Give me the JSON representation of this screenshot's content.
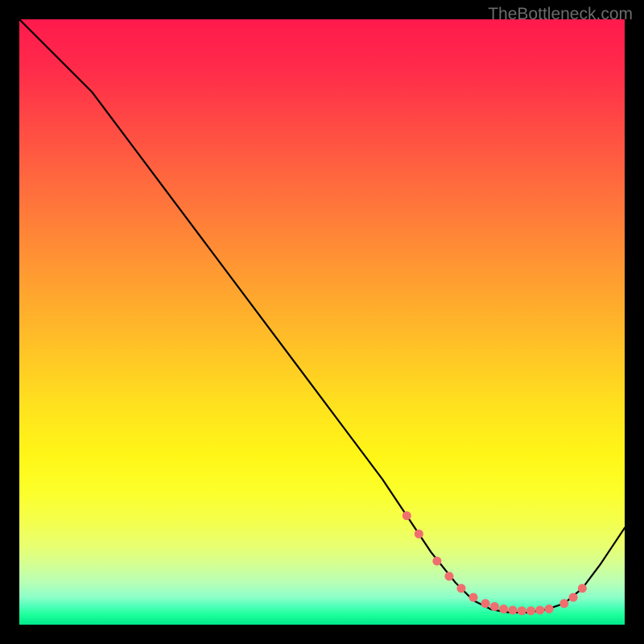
{
  "watermark": "TheBottleneck.com",
  "chart_data": {
    "type": "line",
    "title": "",
    "xlabel": "",
    "ylabel": "",
    "xlim": [
      0,
      100
    ],
    "ylim": [
      0,
      100
    ],
    "gradient_stops": [
      {
        "pos": 0,
        "color": "#ff1a4d"
      },
      {
        "pos": 50,
        "color": "#ffc020"
      },
      {
        "pos": 85,
        "color": "#f0ff40"
      },
      {
        "pos": 100,
        "color": "#00e68c"
      }
    ],
    "series": [
      {
        "name": "bottleneck-curve",
        "x": [
          0,
          6,
          12,
          18,
          24,
          30,
          36,
          42,
          48,
          54,
          60,
          64,
          68,
          72,
          75,
          78,
          81,
          84,
          87,
          90,
          93,
          96,
          100
        ],
        "y": [
          100,
          94,
          88,
          80,
          72,
          64,
          56,
          48,
          40,
          32,
          24,
          18,
          12,
          7,
          4,
          2.5,
          2,
          2,
          2.5,
          3.5,
          6,
          10,
          16
        ]
      }
    ],
    "markers": {
      "name": "highlight-dots",
      "color": "#ef6f6f",
      "x": [
        64,
        66,
        69,
        71,
        73,
        75,
        77,
        78.5,
        80,
        81.5,
        83,
        84.5,
        86,
        87.5,
        90,
        91.5,
        93
      ],
      "y": [
        18,
        15,
        10.5,
        8,
        6,
        4.5,
        3.5,
        3,
        2.6,
        2.4,
        2.3,
        2.3,
        2.4,
        2.6,
        3.5,
        4.5,
        6
      ]
    }
  }
}
